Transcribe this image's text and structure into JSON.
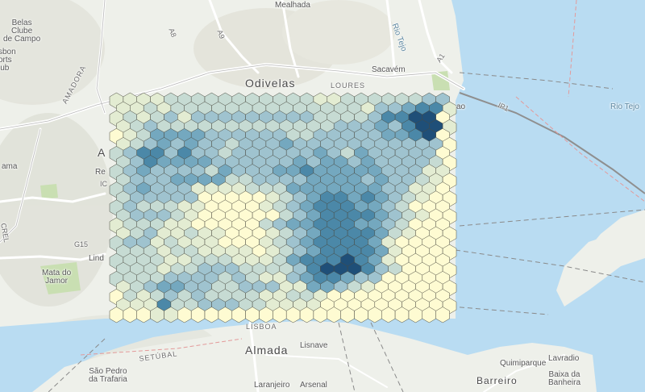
{
  "map": {
    "labels": {
      "mealhada": "Mealhada",
      "belas": "Belas\nClube\nde Campo",
      "lisbon_sports": "sbon\norts\nlub",
      "odivelas": "Odivelas",
      "sacavem": "Sacavém",
      "loures": "LOURES",
      "amadora": "AMADORA",
      "ama": "ama",
      "re": "Re",
      "a": "A",
      "ic": "IC",
      "crel": "CREL",
      "g15": "G15",
      "lind": "Lind",
      "mata_jamor": "Mata do\nJamor",
      "a9": "A9",
      "rio_tejo_small": "Rio Tejo",
      "rio_tejo": "Rio Tejo",
      "ip1": "IP1",
      "a1": "A1",
      "a8": "A8",
      "lisboa": "LISBOA",
      "almada": "Almada",
      "setubal": "SETÚBAL",
      "lisnave": "Lisnave",
      "sao_pedro": "São Pedro\nda Trafaria",
      "laranjeiro": "Laranjeiro",
      "arsenal": "Arsenal",
      "barreiro": "Barreiro",
      "quimiparque": "Quimiparque",
      "lavradio": "Lavradio",
      "baixa_banheira": "Baixa da\nBanheira",
      "ao": "ao"
    },
    "colors": {
      "land": "#eef0ea",
      "water": "#b9dcf2",
      "hex_ramp": [
        "#fefbd2",
        "#e3ecd2",
        "#c6dbd3",
        "#9fc3cf",
        "#74a8bf",
        "#4b88a8",
        "#1f4f78"
      ]
    },
    "hex_grid": {
      "rows": 25,
      "cols": 25,
      "levels": [
        "1111222222222221122222233",
        "1121222222222222221334551",
        "1212313333333332222355660",
        "1232222222222222333435661",
        "0124444333333223333344560",
        "1234343323334333333333330",
        "2355353323333334324333330",
        "2354444333333434434333320",
        "2343333243334454444433311",
        "2333444422333344443433210",
        "2343331111222444444433110",
        "2333330000012345545432100",
        "2322211000012345554432000",
        "2333210000002345555432100",
        "1222110000023445554432000",
        "1231121100012345555421000",
        "2331211100012345555410000",
        "2221221111012345555410000",
        "2222112221112455565410000",
        "2221223332222356665320000",
        "2222333323211345543300000",
        "1234433223331144321000000",
        "0212323222211221000000000",
        "1115223332211110000000000",
        "0001100000000000000000000"
      ]
    }
  }
}
